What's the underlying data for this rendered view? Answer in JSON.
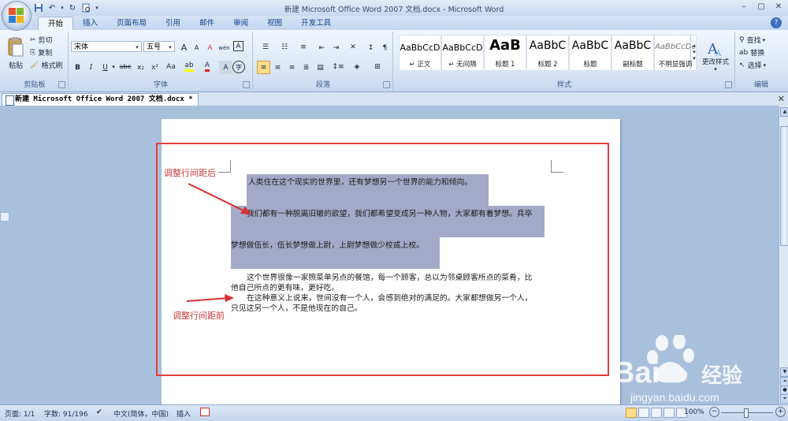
{
  "window": {
    "title": "新建 Microsoft Office Word 2007 文档.docx - Microsoft Word",
    "controls": [
      "–",
      "▢",
      "✕"
    ]
  },
  "qat": {
    "icons": [
      "save-icon",
      "undo-icon",
      "redo-icon",
      "print-preview-icon"
    ]
  },
  "tabs": [
    {
      "label": "开始",
      "active": true
    },
    {
      "label": "插入"
    },
    {
      "label": "页面布局"
    },
    {
      "label": "引用"
    },
    {
      "label": "邮件"
    },
    {
      "label": "审阅"
    },
    {
      "label": "视图"
    },
    {
      "label": "开发工具"
    }
  ],
  "ribbon": {
    "clipboard": {
      "label": "剪贴板",
      "paste": "粘贴",
      "cut": "剪切",
      "copy": "复制",
      "format_painter": "格式刷"
    },
    "font": {
      "label": "字体",
      "font_name": "宋体",
      "font_size": "五号",
      "bold": "B",
      "italic": "I",
      "underline": "U",
      "strike": "abe",
      "sub": "x₂",
      "sup": "x²",
      "aa": "Aa",
      "font_color": "A",
      "grow": "A",
      "shrink": "A",
      "clear": "A",
      "wen": "wén",
      "char_border": "A",
      "enclose": "字"
    },
    "paragraph": {
      "label": "段落"
    },
    "styles": {
      "label": "样式",
      "tiles": [
        {
          "sample": "AaBbCcD",
          "name": "↵ 正文"
        },
        {
          "sample": "AaBbCcD",
          "name": "↵ 无间隔"
        },
        {
          "sample": "AaB",
          "name": "标题 1"
        },
        {
          "sample": "AaBbC",
          "name": "标题 2"
        },
        {
          "sample": "AaBbC",
          "name": "标题"
        },
        {
          "sample": "AaBbC",
          "name": "副标题"
        },
        {
          "sample": "AaBbCcDc",
          "name": "不明显强调"
        }
      ],
      "change_styles": "更改样式"
    },
    "editing": {
      "label": "编辑",
      "find": "查找",
      "replace": "替换",
      "select": "选择"
    }
  },
  "doc_tab": {
    "label": "新建 Microsoft Office Word 2007 文档.docx *"
  },
  "document": {
    "lines": [
      "人类住在这个现实的世界里，还有梦想另一个世界的能力和倾向。",
      "我们都有一种脱离旧辙的欲望，我们都希望变成另一种人物，大家都有着梦想。兵卒",
      "梦想做伍长，伍长梦想做上尉，上尉梦想做少校或上校。",
      "这个世界很像一家照菜单另点的餐馆，每一个顾客，总以为邻桌顾客所点的菜肴，比",
      "他自己所点的更有味，更好吃。",
      "在这种意义上说来，世间没有一个人，会感到绝对的满足的。大家都想做另一个人，",
      "只见这另一个人，不是他现在的自己。"
    ]
  },
  "annotations": {
    "after": "调整行间距后",
    "before": "调整行间距前",
    "color": "#c93a3a"
  },
  "status": {
    "page": "页面: 1/1",
    "words": "字数: 91/196",
    "language": "中文(简体，中国)",
    "insert": "插入",
    "zoom": "100%"
  },
  "watermark": {
    "brand": "Bai",
    "brand_cn": "经验",
    "url": "jingyan.baidu.com"
  }
}
